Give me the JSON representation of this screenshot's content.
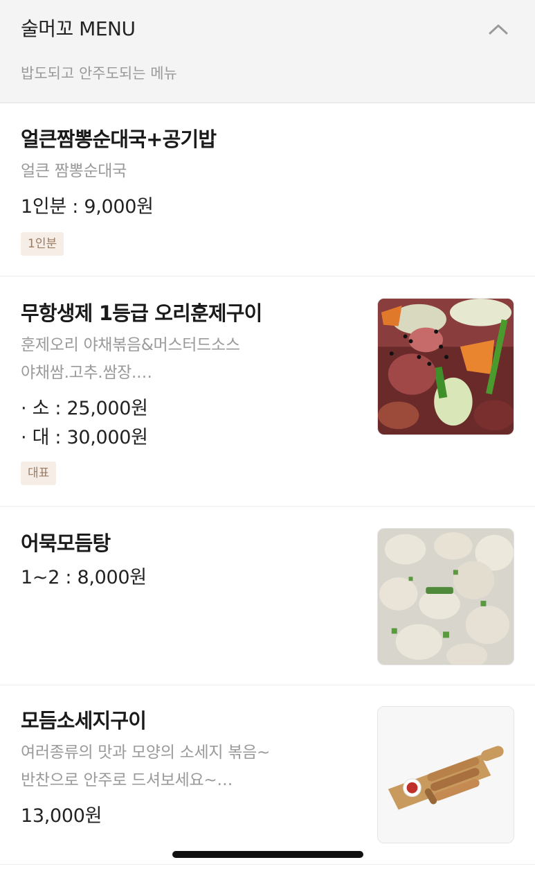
{
  "header": {
    "title": "술머꼬 MENU",
    "subtitle": "밥도되고 안주도되는 메뉴",
    "collapse_icon": "chevron-up-icon"
  },
  "items": [
    {
      "name": "얼큰짬뽕순대국+공기밥",
      "description": "얼큰 짬뽕순대국",
      "prices": [
        "1인분 : 9,000원"
      ],
      "tag": "1인분"
    },
    {
      "name": "무항생제 1등급 오리훈제구이",
      "description_lines": [
        "훈제오리 야채볶음&머스터드소스",
        "야채쌈.고추.쌈장.…"
      ],
      "prices": [
        "· 소 : 25,000원",
        "· 대 : 30,000원"
      ],
      "tag": "대표",
      "image": "smoked-duck-stirfry-photo"
    },
    {
      "name": "어묵모듬탕",
      "prices": [
        "1~2 : 8,000원"
      ],
      "image": "fishcake-soup-photo"
    },
    {
      "name": "모듬소세지구이",
      "description_lines": [
        "여러종류의 맛과 모양의 소세지 볶음~",
        "반찬으로 안주로 드셔보세요~…"
      ],
      "prices": [
        "13,000원"
      ],
      "image": "grilled-sausage-board-photo"
    }
  ]
}
